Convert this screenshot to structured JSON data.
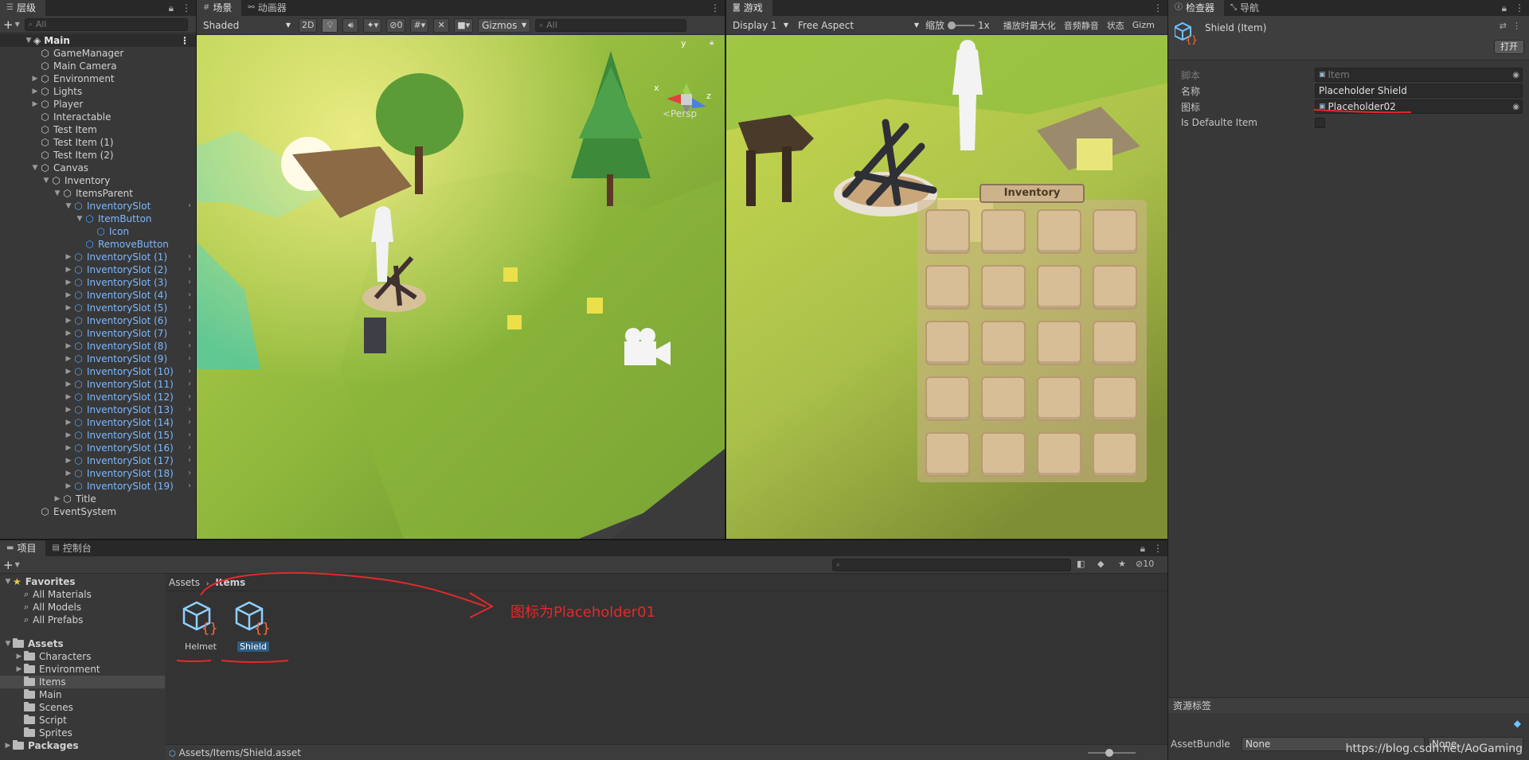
{
  "hierarchy": {
    "tab": "层级",
    "add": "+",
    "search_placeholder": "All",
    "scene_name": "Main",
    "items": [
      {
        "label": "GameManager",
        "depth": 1,
        "arrow": "",
        "blue": false
      },
      {
        "label": "Main Camera",
        "depth": 1,
        "arrow": "",
        "blue": false
      },
      {
        "label": "Environment",
        "depth": 1,
        "arrow": "▶",
        "blue": false
      },
      {
        "label": "Lights",
        "depth": 1,
        "arrow": "▶",
        "blue": false
      },
      {
        "label": "Player",
        "depth": 1,
        "arrow": "▶",
        "blue": false
      },
      {
        "label": "Interactable",
        "depth": 1,
        "arrow": "",
        "blue": false
      },
      {
        "label": "Test Item",
        "depth": 1,
        "arrow": "",
        "blue": false
      },
      {
        "label": "Test Item (1)",
        "depth": 1,
        "arrow": "",
        "blue": false
      },
      {
        "label": "Test Item (2)",
        "depth": 1,
        "arrow": "",
        "blue": false
      },
      {
        "label": "Canvas",
        "depth": 1,
        "arrow": "▼",
        "blue": false
      },
      {
        "label": "Inventory",
        "depth": 2,
        "arrow": "▼",
        "blue": false
      },
      {
        "label": "ItemsParent",
        "depth": 3,
        "arrow": "▼",
        "blue": false
      },
      {
        "label": "InventorySlot",
        "depth": 4,
        "arrow": "▼",
        "blue": true,
        "chev": true
      },
      {
        "label": "ItemButton",
        "depth": 5,
        "arrow": "▼",
        "blue": true
      },
      {
        "label": "Icon",
        "depth": 6,
        "arrow": "",
        "blue": true
      },
      {
        "label": "RemoveButton",
        "depth": 5,
        "arrow": "",
        "blue": true
      },
      {
        "label": "InventorySlot (1)",
        "depth": 4,
        "arrow": "▶",
        "blue": true,
        "chev": true
      },
      {
        "label": "InventorySlot (2)",
        "depth": 4,
        "arrow": "▶",
        "blue": true,
        "chev": true
      },
      {
        "label": "InventorySlot (3)",
        "depth": 4,
        "arrow": "▶",
        "blue": true,
        "chev": true
      },
      {
        "label": "InventorySlot (4)",
        "depth": 4,
        "arrow": "▶",
        "blue": true,
        "chev": true
      },
      {
        "label": "InventorySlot (5)",
        "depth": 4,
        "arrow": "▶",
        "blue": true,
        "chev": true
      },
      {
        "label": "InventorySlot (6)",
        "depth": 4,
        "arrow": "▶",
        "blue": true,
        "chev": true
      },
      {
        "label": "InventorySlot (7)",
        "depth": 4,
        "arrow": "▶",
        "blue": true,
        "chev": true
      },
      {
        "label": "InventorySlot (8)",
        "depth": 4,
        "arrow": "▶",
        "blue": true,
        "chev": true
      },
      {
        "label": "InventorySlot (9)",
        "depth": 4,
        "arrow": "▶",
        "blue": true,
        "chev": true
      },
      {
        "label": "InventorySlot (10)",
        "depth": 4,
        "arrow": "▶",
        "blue": true,
        "chev": true
      },
      {
        "label": "InventorySlot (11)",
        "depth": 4,
        "arrow": "▶",
        "blue": true,
        "chev": true
      },
      {
        "label": "InventorySlot (12)",
        "depth": 4,
        "arrow": "▶",
        "blue": true,
        "chev": true
      },
      {
        "label": "InventorySlot (13)",
        "depth": 4,
        "arrow": "▶",
        "blue": true,
        "chev": true
      },
      {
        "label": "InventorySlot (14)",
        "depth": 4,
        "arrow": "▶",
        "blue": true,
        "chev": true
      },
      {
        "label": "InventorySlot (15)",
        "depth": 4,
        "arrow": "▶",
        "blue": true,
        "chev": true
      },
      {
        "label": "InventorySlot (16)",
        "depth": 4,
        "arrow": "▶",
        "blue": true,
        "chev": true
      },
      {
        "label": "InventorySlot (17)",
        "depth": 4,
        "arrow": "▶",
        "blue": true,
        "chev": true
      },
      {
        "label": "InventorySlot (18)",
        "depth": 4,
        "arrow": "▶",
        "blue": true,
        "chev": true
      },
      {
        "label": "InventorySlot (19)",
        "depth": 4,
        "arrow": "▶",
        "blue": true,
        "chev": true
      },
      {
        "label": "Title",
        "depth": 3,
        "arrow": "▶",
        "blue": false
      },
      {
        "label": "EventSystem",
        "depth": 1,
        "arrow": "",
        "blue": false
      }
    ]
  },
  "scene": {
    "tab": "场景",
    "tab2": "动画器",
    "shading": "Shaded",
    "mode_2d": "2D",
    "hidden_count": "0",
    "gizmos": "Gizmos",
    "search_placeholder": "All",
    "persp": "<Persp",
    "axis_x": "x",
    "axis_y": "y",
    "axis_z": "z"
  },
  "game": {
    "tab": "游戏",
    "display": "Display 1",
    "aspect": "Free Aspect",
    "scale_label": "缩放",
    "scale_value": "1x",
    "maximize": "播放时最大化",
    "mute": "音频静音",
    "stats": "状态",
    "gizmos": "Gizm",
    "inventory_title": "Inventory",
    "slot_rows": 5,
    "slot_cols": 4
  },
  "inspector": {
    "tab": "检查器",
    "tab2": "导航",
    "title": "Shield (Item)",
    "open_button": "打开",
    "props": [
      {
        "label": "脚本",
        "value": "Item",
        "disabled": true,
        "ref": true
      },
      {
        "label": "名称",
        "value": "Placeholder Shield",
        "disabled": false,
        "ref": false
      },
      {
        "label": "图标",
        "value": "Placeholder02",
        "disabled": false,
        "ref": true
      },
      {
        "label": "Is Defaulte Item",
        "value": "",
        "disabled": false,
        "ref": false,
        "checkbox": true
      }
    ],
    "asset_labels": "资源标签",
    "assetbundle_label": "AssetBundle",
    "assetbundle_value": "None",
    "assetbundle_variant": "None"
  },
  "project": {
    "tab": "项目",
    "tab2": "控制台",
    "add": "+",
    "hidden_count": "10",
    "breadcrumb_root": "Assets",
    "breadcrumb_current": "Items",
    "tree": [
      {
        "label": "Favorites",
        "kind": "star",
        "depth": 0,
        "arrow": "▼",
        "bold": true
      },
      {
        "label": "All Materials",
        "kind": "search",
        "depth": 1,
        "arrow": ""
      },
      {
        "label": "All Models",
        "kind": "search",
        "depth": 1,
        "arrow": ""
      },
      {
        "label": "All Prefabs",
        "kind": "search",
        "depth": 1,
        "arrow": ""
      },
      {
        "label": "Assets",
        "kind": "folder",
        "depth": 0,
        "arrow": "▼",
        "bold": true
      },
      {
        "label": "Characters",
        "kind": "folder",
        "depth": 1,
        "arrow": "▶"
      },
      {
        "label": "Environment",
        "kind": "folder",
        "depth": 1,
        "arrow": "▶"
      },
      {
        "label": "Items",
        "kind": "folder",
        "depth": 1,
        "arrow": "",
        "selected": true
      },
      {
        "label": "Main",
        "kind": "folder",
        "depth": 1,
        "arrow": ""
      },
      {
        "label": "Scenes",
        "kind": "folder",
        "depth": 1,
        "arrow": ""
      },
      {
        "label": "Script",
        "kind": "folder",
        "depth": 1,
        "arrow": ""
      },
      {
        "label": "Sprites",
        "kind": "folder",
        "depth": 1,
        "arrow": ""
      },
      {
        "label": "Packages",
        "kind": "folder",
        "depth": 0,
        "arrow": "▶",
        "bold": true
      }
    ],
    "assets": [
      {
        "label": "Helmet",
        "selected": false
      },
      {
        "label": "Shield",
        "selected": true
      }
    ],
    "status_path": "Assets/Items/Shield.asset"
  },
  "annotation": {
    "text": "图标为Placeholder01",
    "color": "#e5282b"
  },
  "watermark": "https://blog.csdn.net/AoGaming"
}
